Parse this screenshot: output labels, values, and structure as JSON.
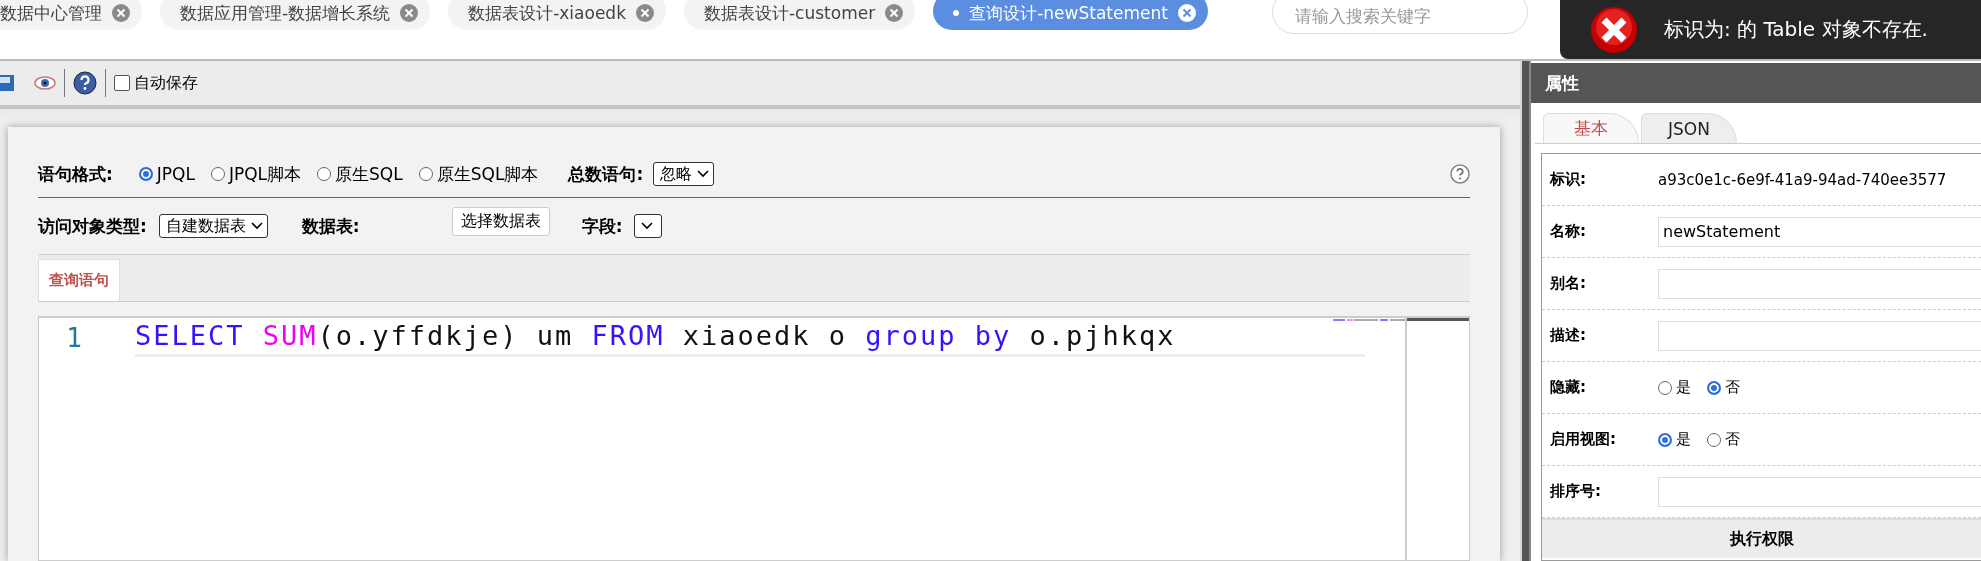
{
  "tabs": [
    {
      "label": "数据中心管理",
      "selected": false,
      "modified": false
    },
    {
      "label": "数据应用管理-数据增长系统",
      "selected": false,
      "modified": false
    },
    {
      "label": "数据表设计-xiaoedk",
      "selected": false,
      "modified": false
    },
    {
      "label": "数据表设计-customer",
      "selected": false,
      "modified": false
    },
    {
      "label": "查询设计-newStatement",
      "selected": true,
      "modified": true
    }
  ],
  "search": {
    "placeholder": "请输入搜索关键字"
  },
  "toast": {
    "message": "标识为: 的 Table 对象不存在."
  },
  "toolbar": {
    "autosave": {
      "label": "自动保存",
      "checked": false
    }
  },
  "query_form": {
    "format": {
      "label": "语句格式:",
      "options": [
        {
          "label": "JPQL",
          "selected": true
        },
        {
          "label": "JPQL脚本",
          "selected": false
        },
        {
          "label": "原生SQL",
          "selected": false
        },
        {
          "label": "原生SQL脚本",
          "selected": false
        }
      ]
    },
    "count": {
      "label": "总数语句:",
      "value": "忽略"
    },
    "access_type": {
      "label": "访问对象类型:",
      "value": "自建数据表"
    },
    "table": {
      "label": "数据表:",
      "button": "选择数据表"
    },
    "field": {
      "label": "字段:"
    }
  },
  "editor_tabs": [
    {
      "label": "查询语句",
      "selected": true
    }
  ],
  "editor": {
    "lines": [
      {
        "number": "1",
        "tokens": [
          {
            "text": "SELECT ",
            "kind": "keyword"
          },
          {
            "text": "SUM",
            "kind": "function"
          },
          {
            "text": "(o.yffdkje) um ",
            "kind": "plain"
          },
          {
            "text": "FROM",
            "kind": "keyword"
          },
          {
            "text": " xiaoedk o ",
            "kind": "plain"
          },
          {
            "text": "group by",
            "kind": "keyword"
          },
          {
            "text": " o.pjhkqx",
            "kind": "plain"
          }
        ]
      }
    ]
  },
  "properties": {
    "title": "属性",
    "tabs": [
      {
        "label": "基本",
        "selected": true
      },
      {
        "label": "JSON",
        "selected": false
      }
    ],
    "fields": [
      {
        "label": "标识:",
        "kind": "text",
        "value": "a93c0e1c-6e9f-41a9-94ad-740ee3577"
      },
      {
        "label": "名称:",
        "kind": "input",
        "value": "newStatement"
      },
      {
        "label": "别名:",
        "kind": "input"
      },
      {
        "label": "描述:",
        "kind": "input"
      },
      {
        "label": "隐藏:",
        "kind": "radio",
        "options": [
          {
            "label": "是",
            "selected": false
          },
          {
            "label": "否",
            "selected": true
          }
        ]
      },
      {
        "label": "启用视图:",
        "kind": "radio",
        "options": [
          {
            "label": "是",
            "selected": true
          },
          {
            "label": "否",
            "selected": false
          }
        ]
      },
      {
        "label": "排序号:",
        "kind": "input"
      }
    ],
    "section": "执行权限"
  }
}
